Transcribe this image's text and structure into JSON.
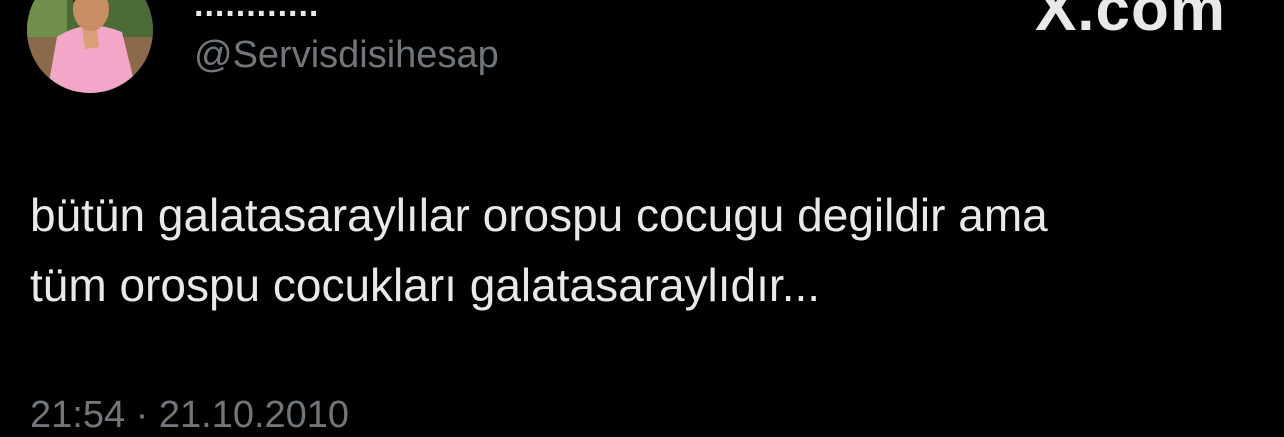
{
  "header": {
    "display_name": "............",
    "handle": "@Servisdisihesap",
    "watermark": "X.com"
  },
  "tweet": {
    "lines": [
      "bütün galatasaraylılar orospu cocugu degildir ama",
      "tüm orospu cocukları galatasaraylıdır..."
    ],
    "timestamp": "21:54 · 21.10.2010"
  },
  "colors": {
    "background": "#000000",
    "primary_text": "#e7e9ea",
    "secondary_text": "#71767b"
  },
  "icons": {
    "avatar": "profile-photo"
  }
}
